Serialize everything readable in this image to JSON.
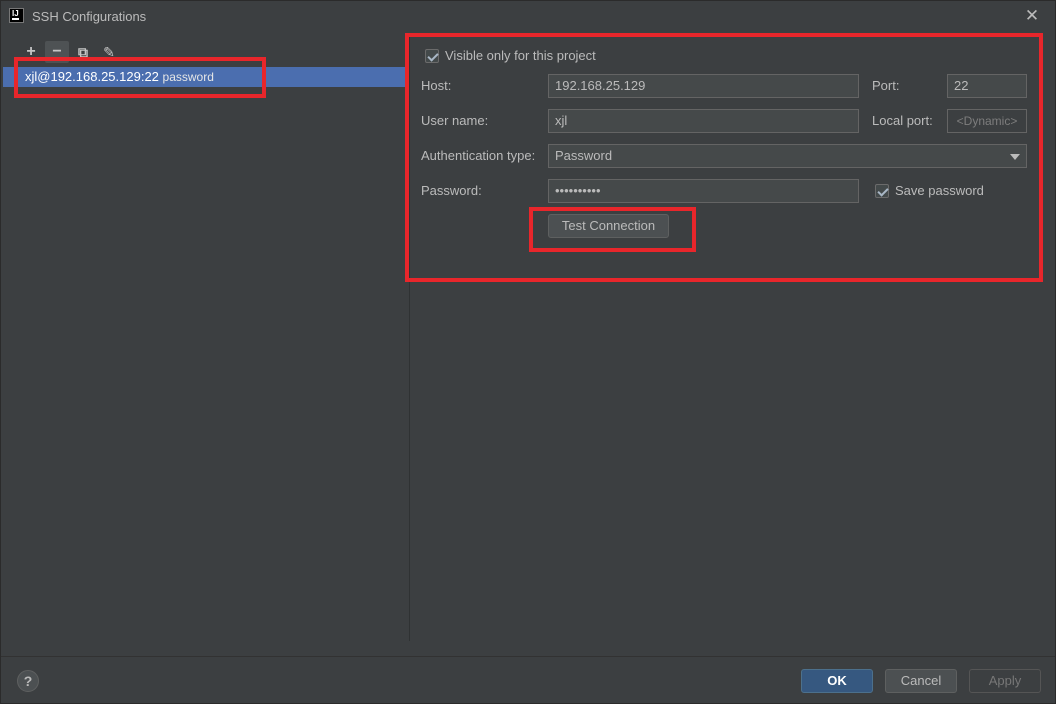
{
  "window": {
    "title": "SSH Configurations",
    "logo_text": "IJ"
  },
  "toolbar": {
    "add_icon": "+",
    "remove_icon": "−",
    "copy_icon": "⧉",
    "edit_icon": "✎"
  },
  "configs": [
    {
      "label": "xjl@192.168.25.129:22",
      "secondary": "password",
      "selected": true
    }
  ],
  "form": {
    "visible_only_label": "Visible only for this project",
    "visible_only_checked": true,
    "host_label": "Host:",
    "host_value": "192.168.25.129",
    "port_label": "Port:",
    "port_value": "22",
    "username_label": "User name:",
    "username_value": "xjl",
    "local_port_label": "Local port:",
    "local_port_placeholder": "<Dynamic>",
    "auth_type_label": "Authentication type:",
    "auth_type_value": "Password",
    "password_label": "Password:",
    "password_value": "••••••••••",
    "save_password_label": "Save password",
    "save_password_checked": true,
    "test_connection_label": "Test Connection"
  },
  "footer": {
    "help_label": "?",
    "ok_label": "OK",
    "cancel_label": "Cancel",
    "apply_label": "Apply"
  },
  "colors": {
    "background": "#3c3f41",
    "selection": "#4b6eaf",
    "primary_button": "#365880",
    "annotation": "#e8262b"
  }
}
